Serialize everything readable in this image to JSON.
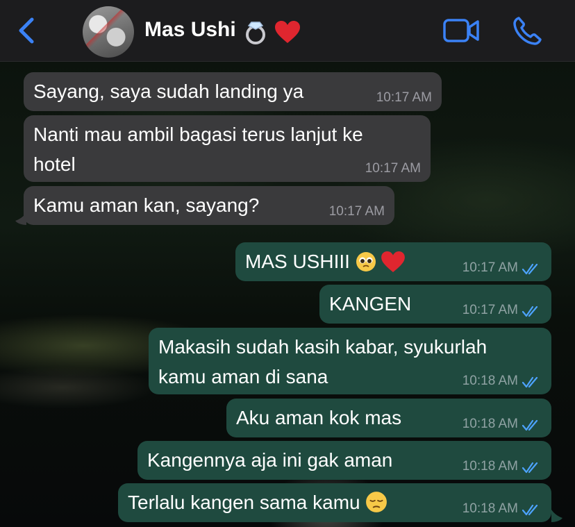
{
  "header": {
    "contact_name": "Mas Ushi",
    "contact_emojis": [
      "ring",
      "red-heart"
    ]
  },
  "colors": {
    "accent": "#3b82f6",
    "incoming_bubble": "#3a3a3c",
    "outgoing_bubble": "#1f4a3f",
    "read_ticks": "#4da3ff"
  },
  "messages": [
    {
      "direction": "in",
      "text": "Sayang, saya sudah landing ya",
      "time": "10:17 AM"
    },
    {
      "direction": "in",
      "text": "Nanti mau ambil bagasi terus lanjut ke\nhotel",
      "time": "10:17 AM"
    },
    {
      "direction": "in",
      "text": "Kamu aman kan, sayang?",
      "time": "10:17 AM"
    },
    {
      "direction": "out",
      "text": "MAS USHIII",
      "emojis": [
        "pleading-face",
        "red-heart"
      ],
      "time": "10:17 AM",
      "status": "read"
    },
    {
      "direction": "out",
      "text": "KANGEN",
      "time": "10:17 AM",
      "status": "read"
    },
    {
      "direction": "out",
      "text": "Makasih sudah kasih kabar, syukurlah\nkamu aman di sana",
      "time": "10:18 AM",
      "status": "read"
    },
    {
      "direction": "out",
      "text": "Aku aman kok mas",
      "time": "10:18 AM",
      "status": "read"
    },
    {
      "direction": "out",
      "text": "Kangennya aja ini gak aman",
      "time": "10:18 AM",
      "status": "read"
    },
    {
      "direction": "out",
      "text": "Terlalu kangen sama kamu",
      "emojis": [
        "pensive-face"
      ],
      "time": "10:18 AM",
      "status": "read"
    }
  ]
}
